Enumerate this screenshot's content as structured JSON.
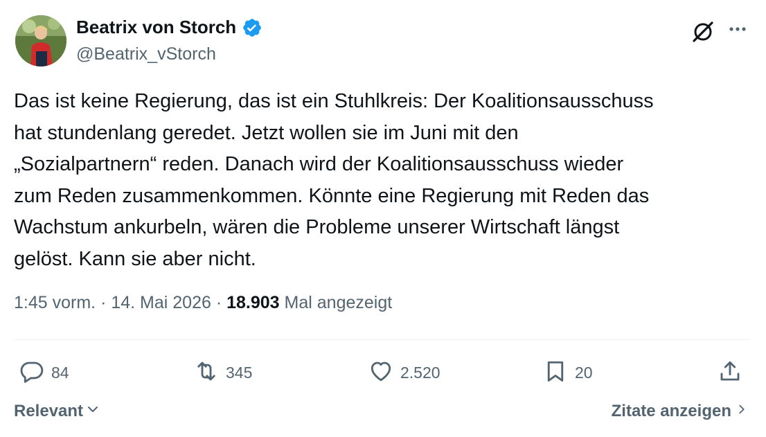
{
  "author": {
    "display_name": "Beatrix von Storch",
    "handle": "@Beatrix_vStorch",
    "verified": true
  },
  "tweet": {
    "lines": [
      "Das ist keine Regierung, das ist ein Stuhlkreis: Der Koalitionsausschuss",
      "hat stundenlang geredet. Jetzt wollen sie im Juni mit den",
      "„Sozialpartnern“ reden. Danach wird der Koalitionsausschuss wieder",
      "zum Reden zusammenkommen. Könnte eine Regierung mit Reden das",
      "Wachstum ankurbeln, wären die Probleme unserer Wirtschaft längst",
      "gelöst. Kann sie aber nicht."
    ],
    "time": "1:45 vorm.",
    "separator": "·",
    "date": "14. Mai 2026",
    "views_count": "18.903",
    "views_label": "Mal angezeigt"
  },
  "actions": {
    "replies": "84",
    "retweets": "345",
    "likes": "2.520",
    "bookmarks": "20"
  },
  "footer": {
    "sort_label": "Relevant",
    "quotes_label": "Zitate anzeigen"
  },
  "icons": {
    "verified": "verified-badge-icon",
    "grok": "grok-icon",
    "more": "more-icon",
    "reply": "reply-icon",
    "retweet": "retweet-icon",
    "like": "heart-icon",
    "bookmark": "bookmark-icon",
    "share": "share-icon"
  },
  "colors": {
    "text": "#0f1419",
    "secondary": "#536471",
    "verified_blue": "#1d9bf0",
    "divider": "#eff3f4"
  }
}
